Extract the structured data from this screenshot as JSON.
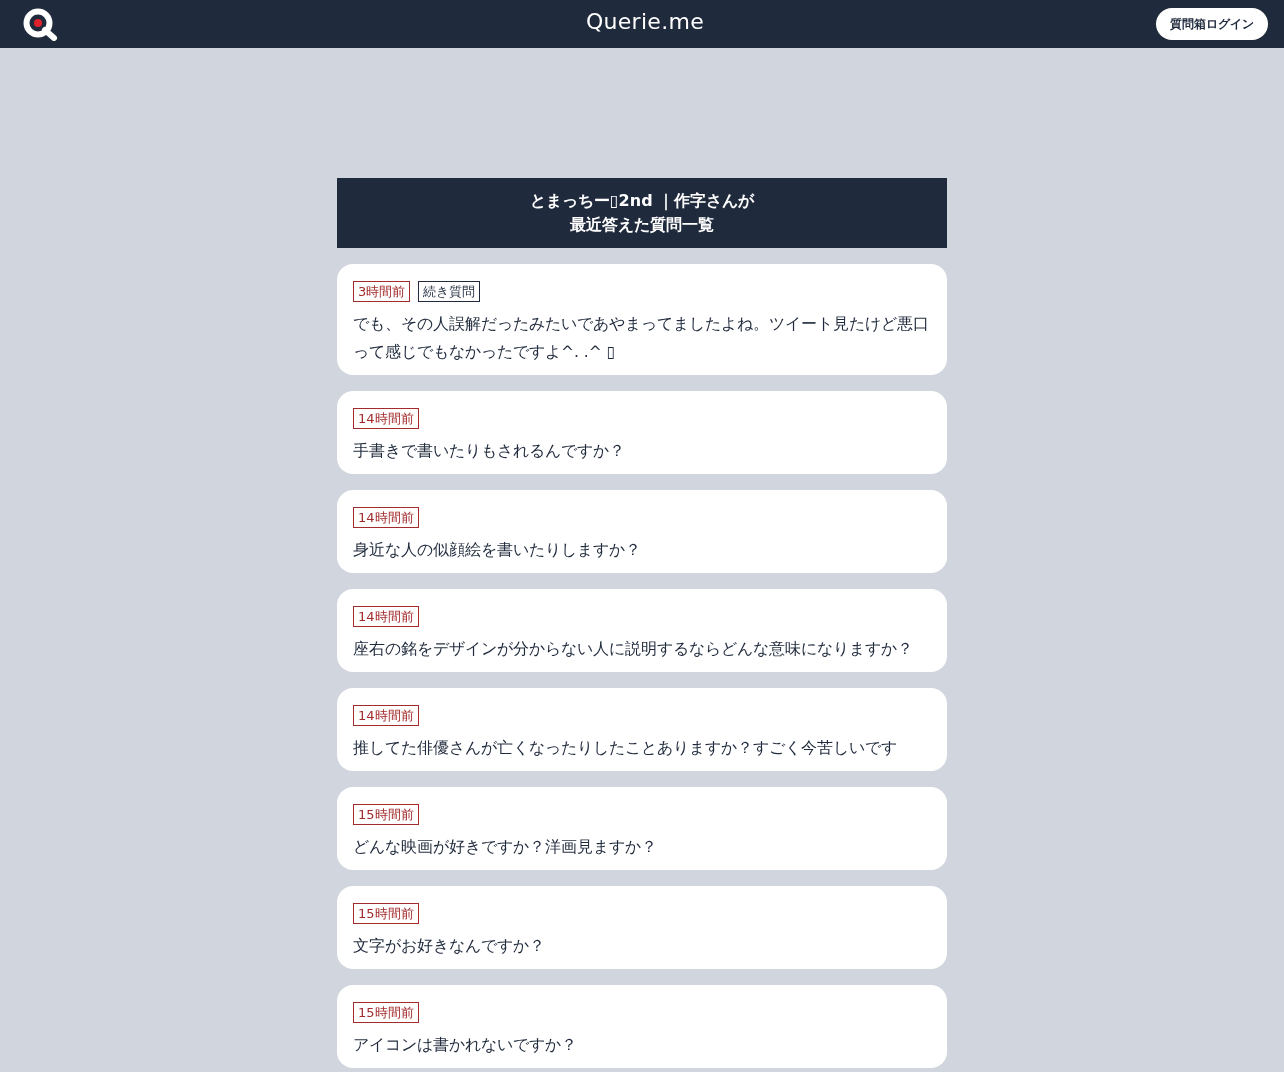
{
  "navbar": {
    "site_name": "Querie.me",
    "login_button": "質問箱ログイン"
  },
  "header": {
    "title_lines": [
      "とまっちー▯2nd ｜作字さんが",
      "最近答えた質問一覧"
    ]
  },
  "questions": [
    {
      "tags": [
        {
          "kind": "time",
          "label": "3時間前"
        },
        {
          "kind": "follow_up",
          "label": "続き質問"
        }
      ],
      "text": "でも、その人誤解だったみたいであやまってましたよね。ツイート見たけど悪口って感じでもなかったですよ^. .^ ▯"
    },
    {
      "tags": [
        {
          "kind": "time",
          "label": "14時間前"
        }
      ],
      "text": "手書きで書いたりもされるんですか？"
    },
    {
      "tags": [
        {
          "kind": "time",
          "label": "14時間前"
        }
      ],
      "text": "身近な人の似顔絵を書いたりしますか？"
    },
    {
      "tags": [
        {
          "kind": "time",
          "label": "14時間前"
        }
      ],
      "text": "座右の銘をデザインが分からない人に説明するならどんな意味になりますか？"
    },
    {
      "tags": [
        {
          "kind": "time",
          "label": "14時間前"
        }
      ],
      "text": "推してた俳優さんが亡くなったりしたことありますか？すごく今苦しいです"
    },
    {
      "tags": [
        {
          "kind": "time",
          "label": "15時間前"
        }
      ],
      "text": "どんな映画が好きですか？洋画見ますか？"
    },
    {
      "tags": [
        {
          "kind": "time",
          "label": "15時間前"
        }
      ],
      "text": "文字がお好きなんですか？"
    },
    {
      "tags": [
        {
          "kind": "time",
          "label": "15時間前"
        }
      ],
      "text": "アイコンは書かれないですか？"
    }
  ]
}
